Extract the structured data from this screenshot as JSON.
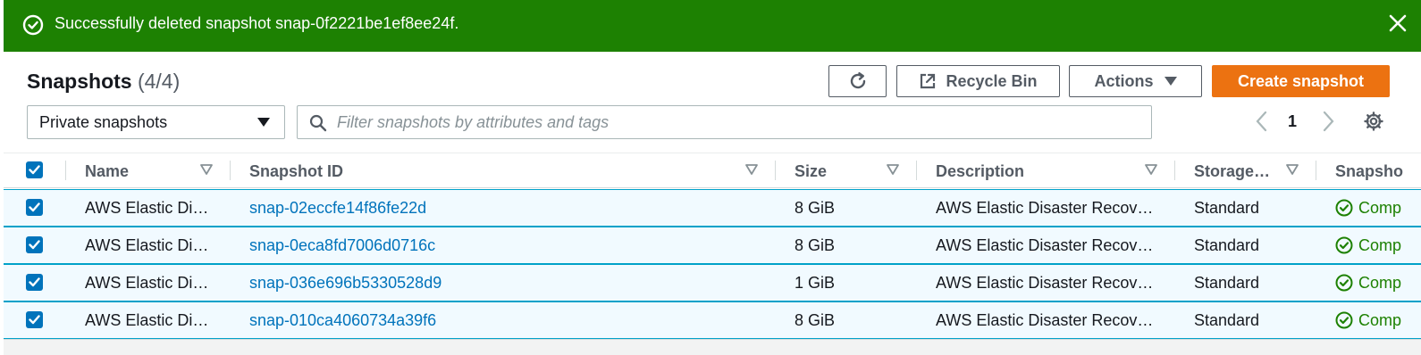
{
  "flash": {
    "message": "Successfully deleted snapshot snap-0f2221be1ef8ee24f.",
    "color": "#1d8102"
  },
  "header": {
    "title": "Snapshots",
    "count": "(4/4)",
    "recycle_bin_label": "Recycle Bin",
    "actions_label": "Actions",
    "create_label": "Create snapshot"
  },
  "filter": {
    "select_value": "Private snapshots",
    "search_placeholder": "Filter snapshots by attributes and tags"
  },
  "pagination": {
    "current_page": "1"
  },
  "table": {
    "columns": [
      "Name",
      "Snapshot ID",
      "Size",
      "Description",
      "Storage…",
      "Snapsho"
    ],
    "rows": [
      {
        "name": "AWS Elastic Di…",
        "snapshot_id": "snap-02eccfe14f86fe22d",
        "size": "8 GiB",
        "description": "AWS Elastic Disaster Recov…",
        "storage": "Standard",
        "status": "Comp"
      },
      {
        "name": "AWS Elastic Di…",
        "snapshot_id": "snap-0eca8fd7006d0716c",
        "size": "8 GiB",
        "description": "AWS Elastic Disaster Recov…",
        "storage": "Standard",
        "status": "Comp"
      },
      {
        "name": "AWS Elastic Di…",
        "snapshot_id": "snap-036e696b5330528d9",
        "size": "1 GiB",
        "description": "AWS Elastic Disaster Recov…",
        "storage": "Standard",
        "status": "Comp"
      },
      {
        "name": "AWS Elastic Di…",
        "snapshot_id": "snap-010ca4060734a39f6",
        "size": "8 GiB",
        "description": "AWS Elastic Disaster Recov…",
        "storage": "Standard",
        "status": "Comp"
      }
    ]
  },
  "colors": {
    "accent": "#0073bb",
    "create_button": "#ec7211",
    "success": "#1d8102",
    "selected_row": "#f1faff"
  }
}
